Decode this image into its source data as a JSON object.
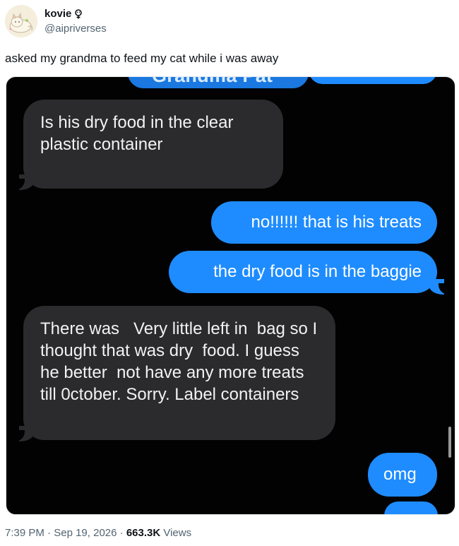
{
  "author": {
    "display_name": "kovie",
    "handle": "@aipriverses"
  },
  "tweet": {
    "text": "asked my grandma to feed my cat while i was away"
  },
  "screenshot": {
    "contact_name_partial": "Grandma Pat",
    "messages": [
      {
        "from": "grandma",
        "text": "Is his  dry food in the clear plastic container"
      },
      {
        "from": "me",
        "text": "no!!!!!! that is his treats"
      },
      {
        "from": "me",
        "text": "the dry food is in the baggie"
      },
      {
        "from": "grandma",
        "text": "There was   Very little left in  bag so I thought that was dry  food. I guess he better  not have any more treats till 0ctober. Sorry. Label containers"
      },
      {
        "from": "me",
        "text": "omg"
      }
    ]
  },
  "meta": {
    "time": "7:39 PM",
    "separator": "·",
    "date": "Sep 19, 2026",
    "views_count": "663.3K",
    "views_label": "Views"
  },
  "colors": {
    "sent_bubble": "#1e8cff",
    "received_bubble": "#2b2b2d",
    "chat_background": "#020202"
  },
  "icons": [
    "avatar-image",
    "badge-icon"
  ]
}
